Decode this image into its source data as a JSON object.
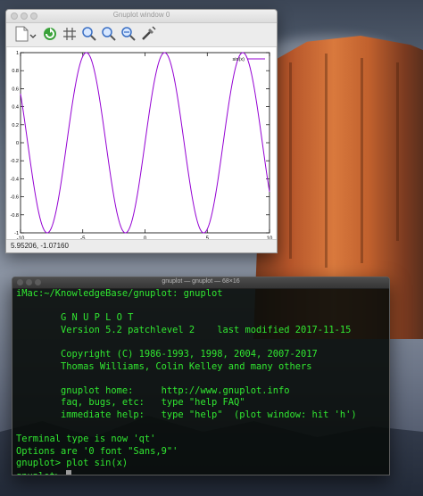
{
  "gnuplot_window": {
    "title": "Gnuplot window 0",
    "status": "5.95206, -1.07160",
    "toolbar": [
      "copy-icon",
      "replot-icon",
      "grid-icon",
      "zoom-prev-icon",
      "zoom-next-icon",
      "autoscale-icon",
      "settings-icon"
    ]
  },
  "terminal": {
    "title": "gnuplot — gnuplot — 68×16",
    "lines": [
      "iMac:~/KnowledgeBase/gnuplot: gnuplot",
      "",
      "        G N U P L O T",
      "        Version 5.2 patchlevel 2    last modified 2017-11-15",
      "",
      "        Copyright (C) 1986-1993, 1998, 2004, 2007-2017",
      "        Thomas Williams, Colin Kelley and many others",
      "",
      "        gnuplot home:     http://www.gnuplot.info",
      "        faq, bugs, etc:   type \"help FAQ\"",
      "        immediate help:   type \"help\"  (plot window: hit 'h')",
      "",
      "Terminal type is now 'qt'",
      "Options are '0 font \"Sans,9\"'",
      "gnuplot> plot sin(x)",
      "gnuplot> "
    ]
  },
  "chart_data": {
    "type": "line",
    "function": "sin(x)",
    "series": [
      {
        "name": "sin(x)",
        "color": "#9400d3"
      }
    ],
    "xlim": [
      -10,
      10
    ],
    "ylim": [
      -1,
      1
    ],
    "x_ticks": [
      "-10",
      "-5",
      "0",
      "5",
      "10"
    ],
    "y_ticks": [
      "1",
      "0.8",
      "0.6",
      "0.4",
      "0.2",
      "0",
      "-0.2",
      "-0.4",
      "-0.6",
      "-0.8",
      "-1"
    ],
    "legend_position": "top-right",
    "grid": false
  },
  "colors": {
    "terminal_text": "#31e831",
    "plot_line": "#9400d3"
  }
}
